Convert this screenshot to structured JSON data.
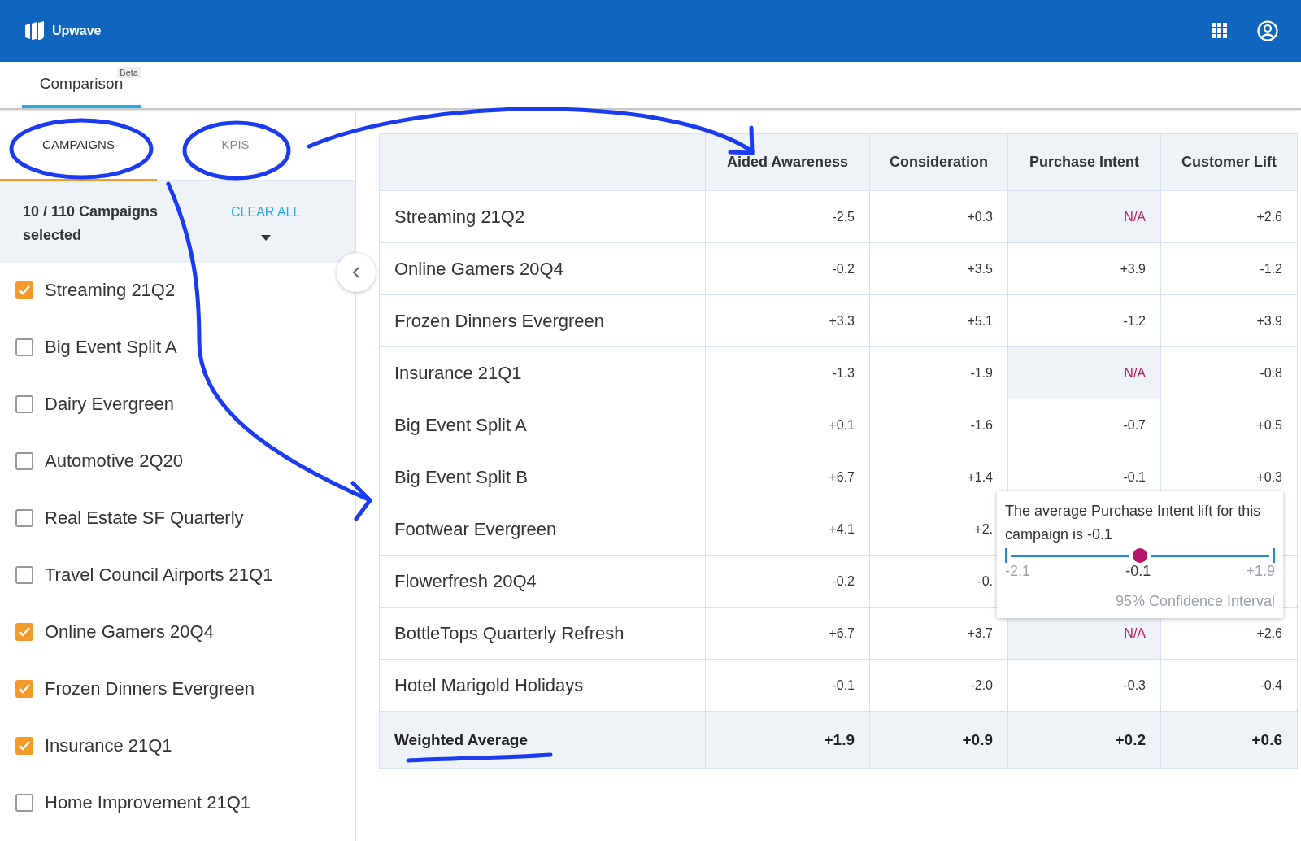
{
  "header": {
    "brand": "Upwave"
  },
  "nav_tabs": [
    {
      "label": "Comparison",
      "badge": "Beta",
      "selected": true
    }
  ],
  "sidebar": {
    "tabs": [
      {
        "label": "CAMPAIGNS",
        "selected": true
      },
      {
        "label": "KPIS",
        "selected": false
      }
    ],
    "summary": "10 / 110 Campaigns selected",
    "clear_all": "CLEAR ALL",
    "campaigns": [
      {
        "name": "Streaming 21Q2",
        "checked": true
      },
      {
        "name": "Big Event Split A",
        "checked": false
      },
      {
        "name": "Dairy Evergreen",
        "checked": false
      },
      {
        "name": "Automotive 2Q20",
        "checked": false
      },
      {
        "name": "Real Estate SF Quarterly",
        "checked": false
      },
      {
        "name": "Travel Council Airports 21Q1",
        "checked": false
      },
      {
        "name": "Online Gamers 20Q4",
        "checked": true
      },
      {
        "name": "Frozen Dinners Evergreen",
        "checked": true
      },
      {
        "name": "Insurance 21Q1",
        "checked": true
      },
      {
        "name": "Home Improvement 21Q1",
        "checked": false
      }
    ]
  },
  "table": {
    "columns": [
      "Aided Awareness",
      "Consideration",
      "Purchase Intent",
      "Customer Lift"
    ],
    "rows": [
      {
        "name": "Streaming 21Q2",
        "cells": [
          {
            "text": "-2.5",
            "kind": "value"
          },
          {
            "text": "+0.3",
            "kind": "value"
          },
          {
            "text": "N/A",
            "kind": "na"
          },
          {
            "text": "+2.6",
            "kind": "value"
          }
        ]
      },
      {
        "name": "Online Gamers 20Q4",
        "cells": [
          {
            "text": "-0.2",
            "kind": "value"
          },
          {
            "text": "+3.5",
            "kind": "value"
          },
          {
            "text": "+3.9",
            "kind": "value"
          },
          {
            "text": "-1.2",
            "kind": "value"
          }
        ]
      },
      {
        "name": "Frozen Dinners Evergreen",
        "cells": [
          {
            "text": "+3.3",
            "kind": "value"
          },
          {
            "text": "+5.1",
            "kind": "value"
          },
          {
            "text": "-1.2",
            "kind": "value"
          },
          {
            "text": "+3.9",
            "kind": "value"
          }
        ]
      },
      {
        "name": "Insurance 21Q1",
        "cells": [
          {
            "text": "-1.3",
            "kind": "value"
          },
          {
            "text": "-1.9",
            "kind": "value"
          },
          {
            "text": "N/A",
            "kind": "na"
          },
          {
            "text": "-0.8",
            "kind": "value"
          }
        ]
      },
      {
        "name": "Big Event Split A",
        "cells": [
          {
            "text": "+0.1",
            "kind": "value"
          },
          {
            "text": "-1.6",
            "kind": "value"
          },
          {
            "text": "-0.7",
            "kind": "value"
          },
          {
            "text": "+0.5",
            "kind": "value"
          }
        ]
      },
      {
        "name": "Big Event Split B",
        "cells": [
          {
            "text": "+6.7",
            "kind": "value"
          },
          {
            "text": "+1.4",
            "kind": "value"
          },
          {
            "text": "-0.1",
            "kind": "value"
          },
          {
            "text": "+0.3",
            "kind": "value"
          }
        ]
      },
      {
        "name": "Footwear Evergreen",
        "cells": [
          {
            "text": "+4.1",
            "kind": "value"
          },
          {
            "text": "+2.",
            "kind": "value"
          },
          {
            "kind": "hidden"
          },
          {
            "kind": "hidden"
          }
        ]
      },
      {
        "name": "Flowerfresh 20Q4",
        "cells": [
          {
            "text": "-0.2",
            "kind": "value"
          },
          {
            "text": "-0.",
            "kind": "value"
          },
          {
            "kind": "hidden"
          },
          {
            "kind": "hidden"
          }
        ]
      },
      {
        "name": "BottleTops Quarterly Refresh",
        "cells": [
          {
            "text": "+6.7",
            "kind": "value"
          },
          {
            "text": "+3.7",
            "kind": "value"
          },
          {
            "text": "N/A",
            "kind": "na"
          },
          {
            "text": "+2.6",
            "kind": "value"
          }
        ]
      },
      {
        "name": "Hotel Marigold Holidays",
        "cells": [
          {
            "text": "-0.1",
            "kind": "value"
          },
          {
            "text": "-2.0",
            "kind": "value"
          },
          {
            "text": "-0.3",
            "kind": "value"
          },
          {
            "text": "-0.4",
            "kind": "value"
          }
        ]
      }
    ],
    "footer": {
      "label": "Weighted Average",
      "values": [
        "+1.9",
        "+0.9",
        "+0.2",
        "+0.6"
      ]
    }
  },
  "tooltip": {
    "text": "The average Purchase Intent lift for this campaign is -0.1",
    "low": "-2.1",
    "value": "-0.1",
    "high": "+1.9",
    "level": 0.5,
    "caption": "95% Confidence Interval"
  }
}
